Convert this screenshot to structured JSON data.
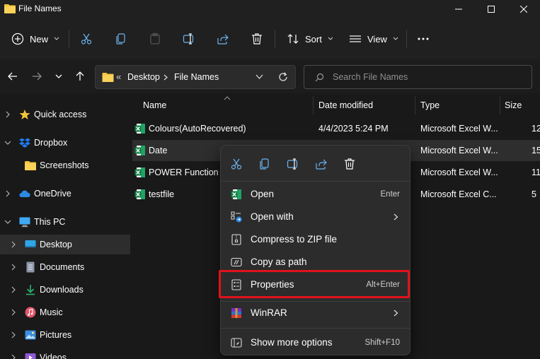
{
  "window": {
    "title": "File Names"
  },
  "toolbar": {
    "new_label": "New",
    "sort_label": "Sort",
    "view_label": "View"
  },
  "address": {
    "overflow": "«",
    "crumbs": [
      "Desktop",
      "File Names"
    ]
  },
  "search": {
    "placeholder": "Search File Names"
  },
  "nav": {
    "items": [
      {
        "label": "Quick access",
        "icon": "star-icon"
      },
      {
        "label": "Dropbox",
        "icon": "dropbox-icon"
      },
      {
        "label": "Screenshots",
        "icon": "folder-icon"
      },
      {
        "label": "OneDrive",
        "icon": "cloud-icon"
      },
      {
        "label": "This PC",
        "icon": "monitor-icon"
      },
      {
        "label": "Desktop",
        "icon": "desktop-icon"
      },
      {
        "label": "Documents",
        "icon": "document-icon"
      },
      {
        "label": "Downloads",
        "icon": "download-icon"
      },
      {
        "label": "Music",
        "icon": "music-icon"
      },
      {
        "label": "Pictures",
        "icon": "pictures-icon"
      },
      {
        "label": "Videos",
        "icon": "video-icon"
      }
    ]
  },
  "columns": {
    "name": "Name",
    "date": "Date modified",
    "type": "Type",
    "size": "Size"
  },
  "files": [
    {
      "name": "Colours(AutoRecovered)",
      "date": "4/4/2023 5:24 PM",
      "type": "Microsoft Excel W...",
      "size": "12"
    },
    {
      "name": "Date",
      "date": "",
      "type": "Microsoft Excel W...",
      "size": "15"
    },
    {
      "name": "POWER Function",
      "date": "",
      "type": "Microsoft Excel W...",
      "size": "11"
    },
    {
      "name": "testfile",
      "date": "",
      "type": "Microsoft Excel C...",
      "size": "5"
    }
  ],
  "context_menu": {
    "open": {
      "label": "Open",
      "shortcut": "Enter"
    },
    "open_with": {
      "label": "Open with"
    },
    "compress": {
      "label": "Compress to ZIP file"
    },
    "copy_path": {
      "label": "Copy as path"
    },
    "properties": {
      "label": "Properties",
      "shortcut": "Alt+Enter"
    },
    "winrar": {
      "label": "WinRAR"
    },
    "more_options": {
      "label": "Show more options",
      "shortcut": "Shift+F10"
    }
  },
  "colors": {
    "highlight": "#e0121b",
    "folder": "#f6c33a",
    "excel": "#1d8f4c",
    "accent": "#4cc2ff"
  }
}
